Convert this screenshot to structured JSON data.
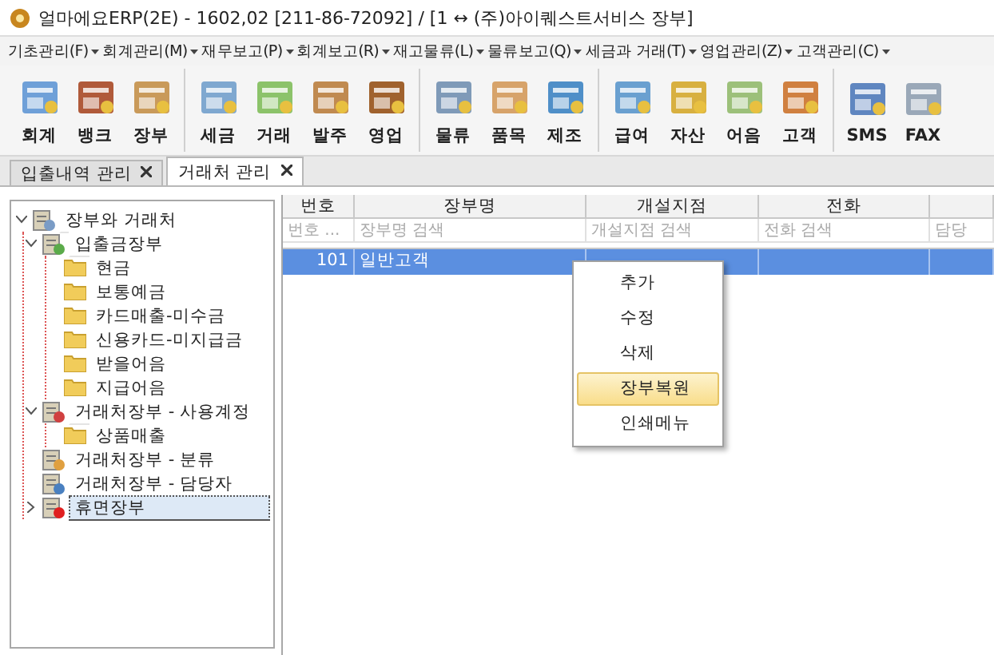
{
  "window": {
    "title": "얼마에요ERP(2E) - 1602,02 [211-86-72092] / [1 ↔ (주)아이퀘스트서비스 장부]"
  },
  "menu": [
    "기초관리(F)",
    "회계관리(M)",
    "재무보고(P)",
    "회계보고(R)",
    "재고물류(L)",
    "물류보고(Q)",
    "세금과 거래(T)",
    "영업관리(Z)",
    "고객관리(C)"
  ],
  "toolbar": [
    [
      "회계",
      "뱅크",
      "장부"
    ],
    [
      "세금",
      "거래",
      "발주",
      "영업"
    ],
    [
      "물류",
      "품목",
      "제조"
    ],
    [
      "급여",
      "자산",
      "어음",
      "고객"
    ],
    [
      "SMS",
      "FAX"
    ]
  ],
  "tabs": [
    {
      "label": "입출내역 관리",
      "selected": false
    },
    {
      "label": "거래처 관리",
      "selected": true
    }
  ],
  "tree": [
    {
      "label": "장부와 거래처",
      "kind": "ledger",
      "expanded": true,
      "selected": false,
      "children": [
        {
          "label": "입출금장부",
          "kind": "cashbook",
          "expanded": true,
          "selected": false,
          "children": [
            {
              "label": "현금",
              "kind": "folder",
              "selected": false
            },
            {
              "label": "보통예금",
              "kind": "folder",
              "selected": false
            },
            {
              "label": "카드매출-미수금",
              "kind": "folder",
              "selected": false
            },
            {
              "label": "신용카드-미지급금",
              "kind": "folder",
              "selected": false
            },
            {
              "label": "받을어음",
              "kind": "folder",
              "selected": false
            },
            {
              "label": "지급어음",
              "kind": "folder",
              "selected": false
            }
          ]
        },
        {
          "label": "거래처장부 - 사용계정",
          "kind": "account",
          "expanded": true,
          "selected": false,
          "children": [
            {
              "label": "상품매출",
              "kind": "folder",
              "selected": false
            }
          ]
        },
        {
          "label": "거래처장부 - 분류",
          "kind": "category",
          "selected": false
        },
        {
          "label": "거래처장부 - 담당자",
          "kind": "person",
          "selected": false
        },
        {
          "label": "휴면장부",
          "kind": "dormant",
          "expanded": false,
          "selected": true
        }
      ]
    }
  ],
  "table": {
    "columns": [
      "번호",
      "장부명",
      "개설지점",
      "전화"
    ],
    "placeholders": [
      "번호 ...",
      "장부명 검색",
      "개설지점 검색",
      "전화 검색",
      "담당"
    ],
    "rows": [
      {
        "cells": [
          "101",
          "일반고객",
          "",
          "",
          ""
        ],
        "selected": true
      }
    ]
  },
  "context_menu": [
    {
      "label": "추가",
      "selected": false
    },
    {
      "label": "수정",
      "selected": false
    },
    {
      "label": "삭제",
      "selected": false
    },
    {
      "label": "장부복원",
      "selected": true
    },
    {
      "label": "인쇄메뉴",
      "selected": false
    }
  ]
}
